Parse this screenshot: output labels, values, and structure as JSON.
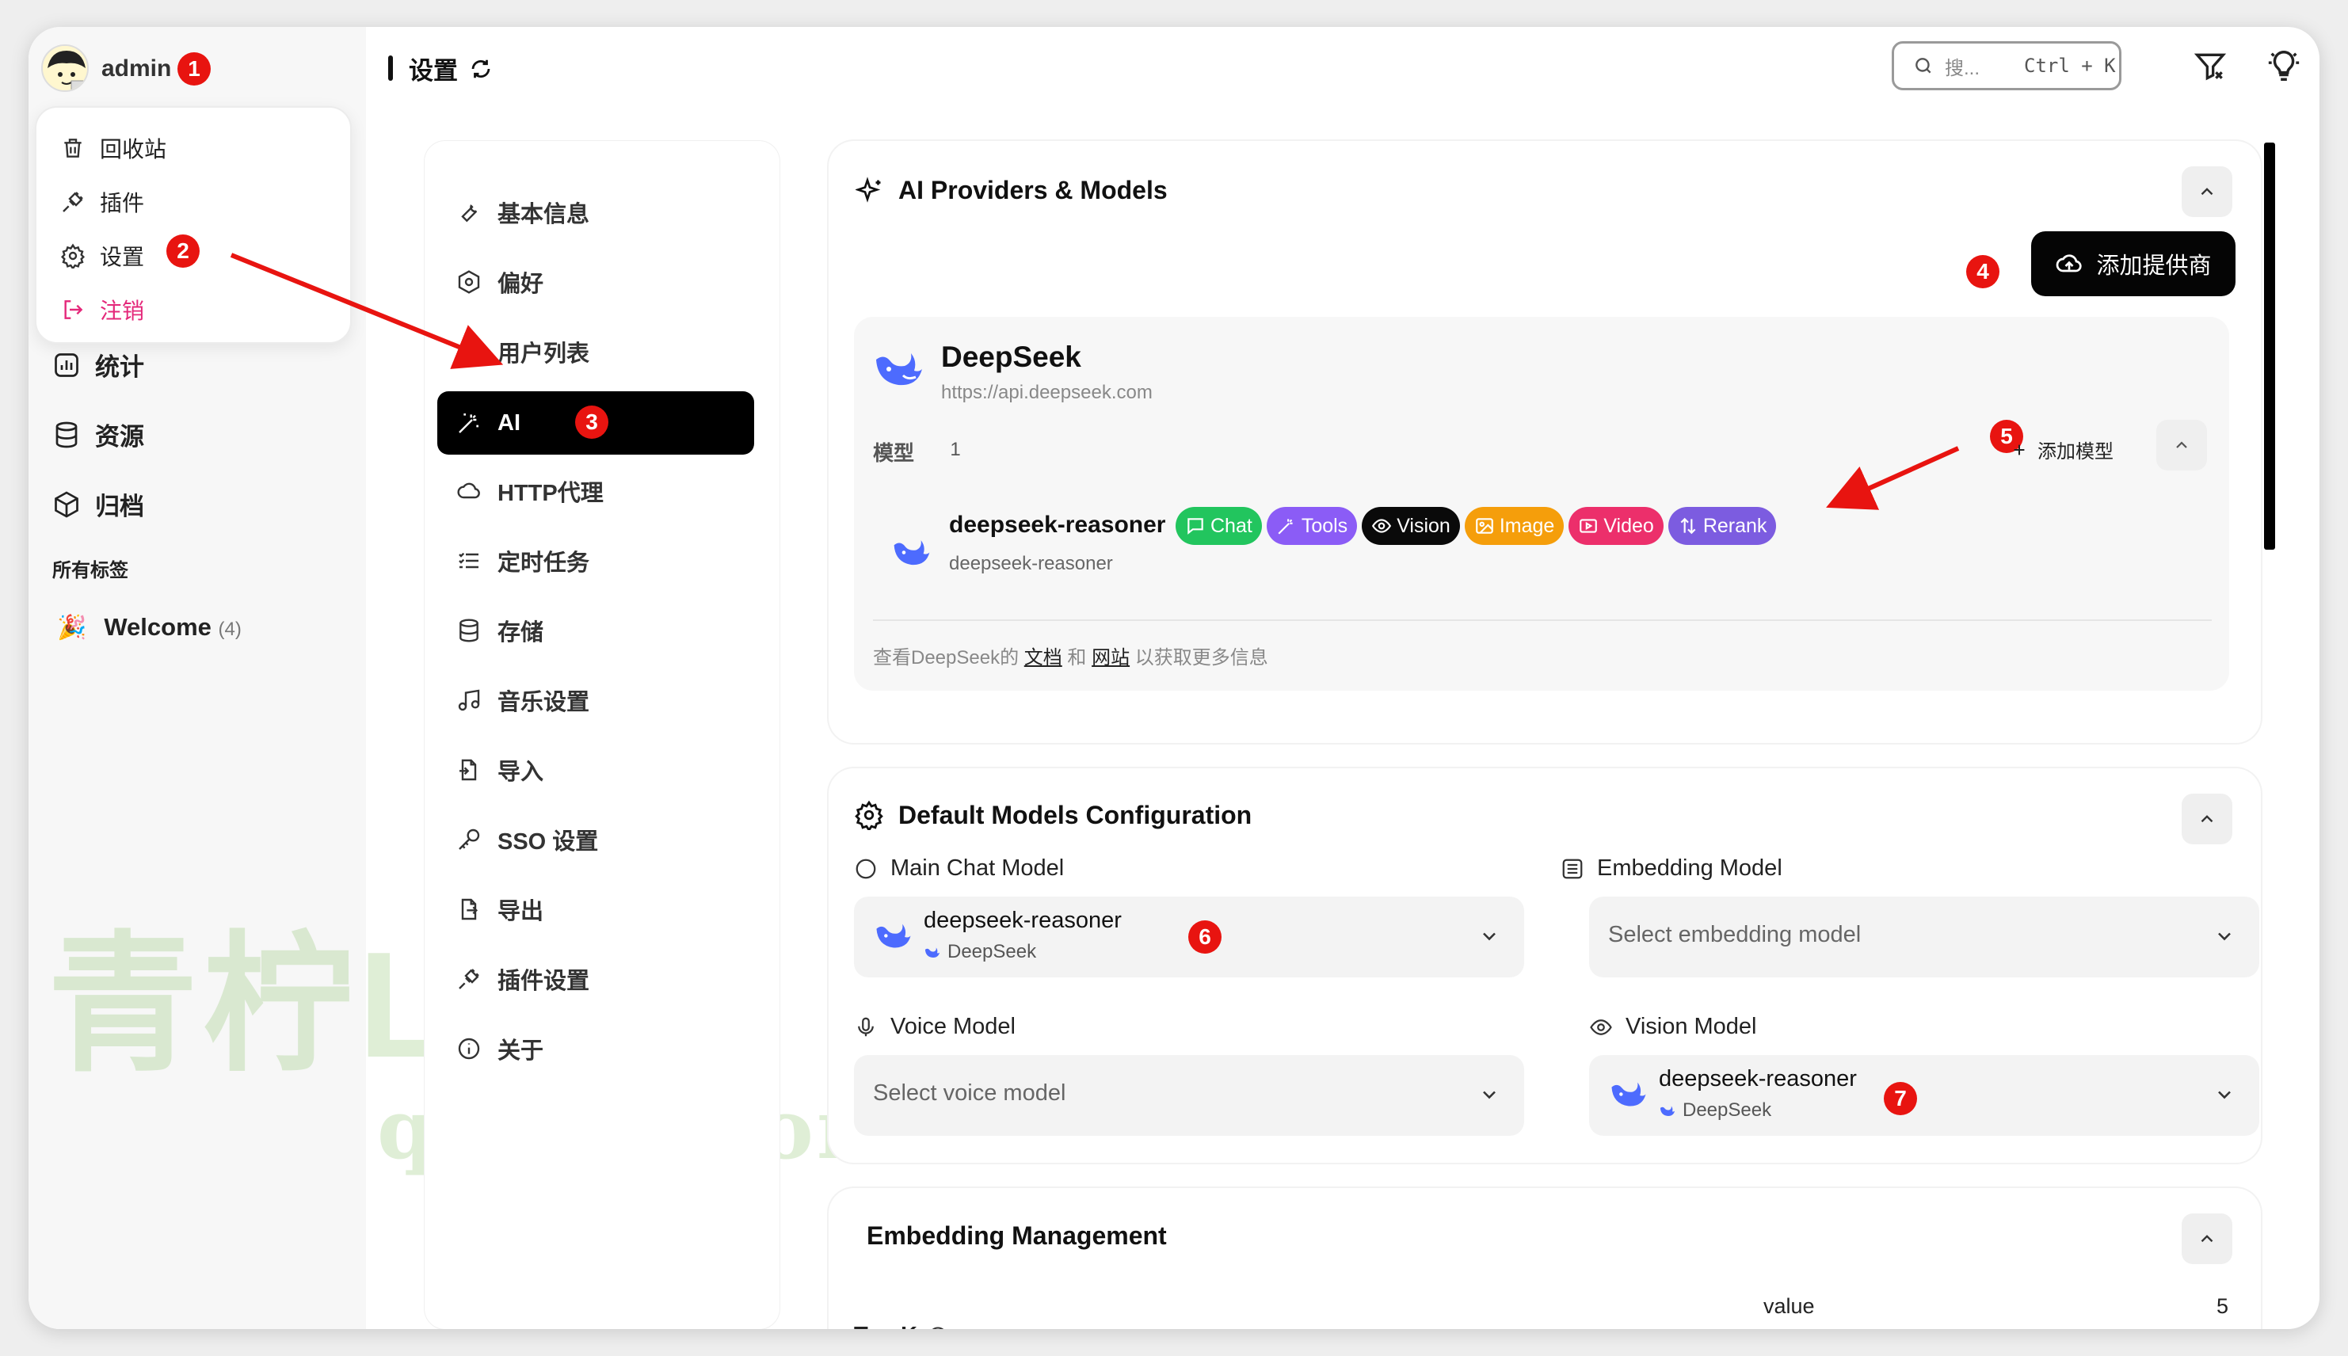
{
  "user": {
    "name": "admin"
  },
  "badges": [
    "1",
    "2",
    "3",
    "4",
    "5",
    "6",
    "7"
  ],
  "user_menu": {
    "items": [
      {
        "label": "回收站",
        "icon": "trash-icon"
      },
      {
        "label": "插件",
        "icon": "plug-icon"
      },
      {
        "label": "设置",
        "icon": "gear-icon"
      },
      {
        "label": "注销",
        "icon": "logout-icon"
      }
    ]
  },
  "sidebar": {
    "items": [
      {
        "label": "统计",
        "icon": "chart-icon"
      },
      {
        "label": "资源",
        "icon": "database-icon"
      },
      {
        "label": "归档",
        "icon": "box-icon"
      }
    ],
    "tags_title": "所有标签",
    "tag": {
      "emoji": "🎉",
      "label": "Welcome",
      "count": "(4)"
    }
  },
  "header": {
    "title": "设置",
    "search_placeholder": "搜...",
    "shortcut": "Ctrl + K"
  },
  "settings_nav": {
    "items": [
      {
        "label": "基本信息",
        "icon": "wrench-icon"
      },
      {
        "label": "偏好",
        "icon": "settings-hex-icon"
      },
      {
        "label": "用户列表",
        "icon": "users-icon"
      },
      {
        "label": "AI",
        "icon": "magic-wand-icon",
        "active": true
      },
      {
        "label": "HTTP代理",
        "icon": "cloud-icon"
      },
      {
        "label": "定时任务",
        "icon": "list-check-icon"
      },
      {
        "label": "存储",
        "icon": "database-icon"
      },
      {
        "label": "音乐设置",
        "icon": "music-icon"
      },
      {
        "label": "导入",
        "icon": "import-icon"
      },
      {
        "label": "SSO 设置",
        "icon": "key-icon"
      },
      {
        "label": "导出",
        "icon": "export-icon"
      },
      {
        "label": "插件设置",
        "icon": "plug-icon"
      },
      {
        "label": "关于",
        "icon": "info-icon"
      }
    ]
  },
  "ai_providers": {
    "title": "AI Providers & Models",
    "add_provider": "添加提供商",
    "provider": {
      "name": "DeepSeek",
      "url": "https://api.deepseek.com",
      "models_label": "模型",
      "models_count": "1",
      "add_model": "添加模型",
      "model": {
        "name": "deepseek-reasoner",
        "id": "deepseek-reasoner",
        "capabilities": [
          {
            "label": "Chat",
            "color": "#22c55e",
            "icon": "chat-icon"
          },
          {
            "label": "Tools",
            "color": "#8b5cf6",
            "icon": "wand-icon"
          },
          {
            "label": "Vision",
            "color": "#0a0a0a",
            "icon": "eye-icon"
          },
          {
            "label": "Image",
            "color": "#f59e0b",
            "icon": "image-icon"
          },
          {
            "label": "Video",
            "color": "#ec2f6b",
            "icon": "video-icon"
          },
          {
            "label": "Rerank",
            "color": "#7c5ce0",
            "icon": "sort-icon"
          }
        ]
      },
      "footer": {
        "prefix": "查看DeepSeek的",
        "docs": "文档",
        "and": "和",
        "site": "网站",
        "suffix": "以获取更多信息"
      }
    }
  },
  "default_models": {
    "title": "Default Models Configuration",
    "main_chat": {
      "label": "Main Chat Model",
      "value": "deepseek-reasoner",
      "provider": "DeepSeek"
    },
    "embedding": {
      "label": "Embedding Model",
      "placeholder": "Select embedding model"
    },
    "voice": {
      "label": "Voice Model",
      "placeholder": "Select voice model"
    },
    "vision": {
      "label": "Vision Model",
      "value": "deepseek-reasoner",
      "provider": "DeepSeek"
    }
  },
  "embedding_mgmt": {
    "title": "Embedding Management",
    "topk_label": "Top K",
    "value_label": "value",
    "value": "5"
  },
  "watermark": {
    "line1": "青柠Loft",
    "line2": "qnloft.com"
  }
}
